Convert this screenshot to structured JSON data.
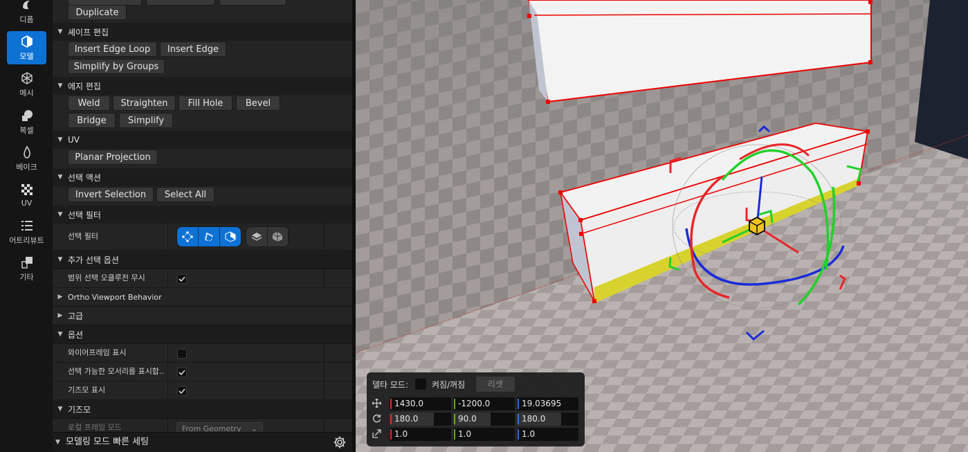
{
  "modes": [
    {
      "label": "디폼",
      "icon": "deform-icon",
      "active": false
    },
    {
      "label": "모델",
      "icon": "model-icon",
      "active": true
    },
    {
      "label": "메시",
      "icon": "mesh-icon",
      "active": false
    },
    {
      "label": "복셀",
      "icon": "voxel-icon",
      "active": false
    },
    {
      "label": "베이크",
      "icon": "bake-icon",
      "active": false
    },
    {
      "label": "UV",
      "icon": "uv-icon",
      "active": false
    },
    {
      "label": "어트리뷰트",
      "icon": "attributes-icon",
      "active": false
    },
    {
      "label": "기타",
      "icon": "misc-icon",
      "active": false
    }
  ],
  "panel": {
    "top_buttons": [
      "Duplicate"
    ],
    "shape_edit": {
      "title": "셰이프 편집",
      "buttons": [
        "Insert Edge Loop",
        "Insert Edge",
        "Simplify by Groups"
      ]
    },
    "edge_edit": {
      "title": "에지 편집",
      "buttons": [
        "Weld",
        "Straighten",
        "Fill Hole",
        "Bevel",
        "Bridge",
        "Simplify"
      ]
    },
    "uv": {
      "title": "UV",
      "buttons": [
        "Planar Projection"
      ]
    },
    "selection_actions": {
      "title": "선택 액션",
      "buttons": [
        "Invert Selection",
        "Select All"
      ]
    },
    "selection_filter": {
      "title": "선택 필터",
      "row_label": "선택 필터"
    },
    "extra_selection": {
      "title": "추가 선택 옵션",
      "row_label": "범위 선택 오클루전 무시",
      "checked": true
    },
    "ortho": {
      "title": "Ortho Viewport Behavior"
    },
    "advanced": {
      "title": "고급"
    },
    "options": {
      "title": "옵션",
      "rows": [
        {
          "label": "와이어프레임 표시",
          "checked": false
        },
        {
          "label": "선택 가능한 모서리를 표시합...",
          "checked": true
        },
        {
          "label": "기즈모 표시",
          "checked": true
        }
      ]
    },
    "gizmo": {
      "title": "기즈모",
      "local_frame_label": "로컬 프레임 모드",
      "local_frame_value": "From Geometry"
    },
    "quick_settings": "모델링 모드 빠른 세팅"
  },
  "transform_widget": {
    "delta_mode_label": "델타 모드:",
    "toggle_label": "켜짐/꺼짐",
    "reset_label": "리셋",
    "location": [
      "1430.0",
      "-1200.0",
      "19.03695"
    ],
    "rotation": [
      "180.0",
      "90.0",
      "180.0"
    ],
    "scale": [
      "1.0",
      "1.0",
      "1.0"
    ],
    "colors": {
      "x": "#c8352a",
      "y": "#6aa32a",
      "z": "#2f6fd6"
    }
  },
  "colors": {
    "accent": "#0e72d5",
    "selection": "#ff2020",
    "gizmo_x": "#e8262a",
    "gizmo_y": "#22d02a",
    "gizmo_z": "#1a2bd8"
  }
}
